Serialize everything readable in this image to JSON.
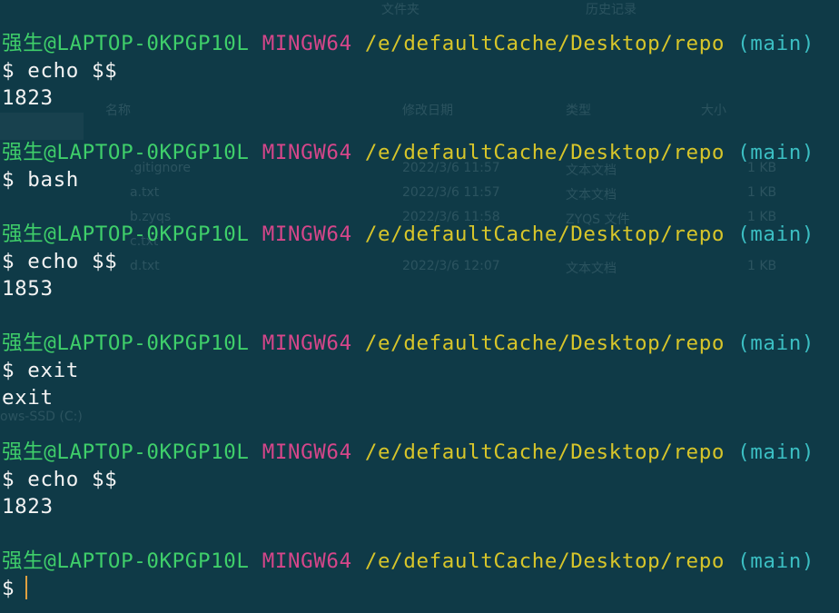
{
  "background_window": {
    "headers": [
      "文件夹",
      "历史记录",
      "名称",
      "修改日期",
      "类型",
      "大小"
    ],
    "files": [
      {
        "name": ".gitignore",
        "date": "2022/3/6 11:57",
        "type": "文本文档",
        "size": "1 KB"
      },
      {
        "name": "a.txt",
        "date": "2022/3/6 11:57",
        "type": "文本文档",
        "size": "1 KB"
      },
      {
        "name": "b.zyqs",
        "date": "2022/3/6 11:58",
        "type": "ZYQS 文件",
        "size": "1 KB"
      },
      {
        "name": "c.txt",
        "date": "",
        "type": "",
        "size": ""
      },
      {
        "name": "d.txt",
        "date": "2022/3/6 12:07",
        "type": "文本文档",
        "size": "1 KB"
      }
    ],
    "drive_label": "ows-SSD (C:)"
  },
  "prompt": {
    "user_host": "强生@LAPTOP-0KPGP10L",
    "system": "MINGW64",
    "path": "/e/defaultCache/Desktop/repo",
    "branch": "(main)"
  },
  "session": [
    {
      "command": "$ echo $$",
      "output": "1823"
    },
    {
      "command": "$ bash",
      "output": ""
    },
    {
      "command": "$ echo $$",
      "output": "1853"
    },
    {
      "command": "$ exit",
      "output": "exit"
    },
    {
      "command": "$ echo $$",
      "output": "1823"
    },
    {
      "command": "$",
      "output": ""
    }
  ],
  "colors": {
    "background": "#0f3a47",
    "user_host": "#3fcf6a",
    "system": "#d6468a",
    "path": "#d7c52a",
    "branch": "#3bbec2",
    "text": "#f3f3f3",
    "cursor": "#e0a040"
  }
}
